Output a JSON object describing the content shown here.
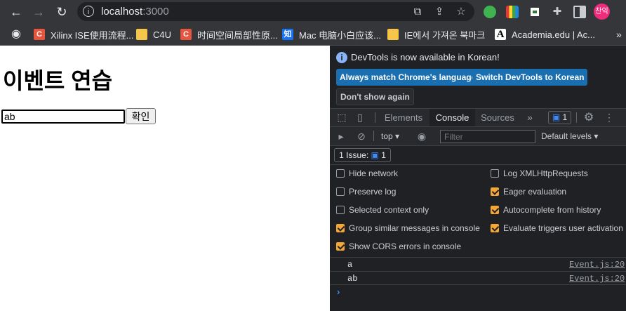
{
  "browser": {
    "url_host": "localhost",
    "url_port": ":3000",
    "profile_initials": "찬익",
    "bookmarks": [
      {
        "label": "Xilinx ISE使用流程...",
        "icon": "C",
        "color": "#e8553e"
      },
      {
        "label": "C4U",
        "icon": "",
        "color": "#f6c64a"
      },
      {
        "label": "时间空间局部性原...",
        "icon": "C",
        "color": "#e8553e"
      },
      {
        "label": "Mac 电脑小白应该...",
        "icon": "知",
        "color": "#1772f6"
      },
      {
        "label": "IE에서 가져온 북마크",
        "icon": "",
        "color": "#f6c64a"
      },
      {
        "label": "Academia.edu | Ac...",
        "icon": "A",
        "color": "#ffffff"
      }
    ]
  },
  "page": {
    "heading": "이벤트 연습",
    "input_value": "ab",
    "confirm_button": "확인"
  },
  "devtools": {
    "info_text": "DevTools is now available in Korean!",
    "btn_match": "Always match Chrome's language",
    "btn_switch": "Switch DevTools to Korean",
    "btn_dont_show": "Don't show again",
    "tabs": [
      "Elements",
      "Console",
      "Sources"
    ],
    "active_tab": "Console",
    "issue_count": "1",
    "context": "top",
    "filter_placeholder": "Filter",
    "levels": "Default levels",
    "issues_label": "1 Issue:",
    "options_left": [
      {
        "label": "Hide network",
        "checked": false
      },
      {
        "label": "Preserve log",
        "checked": false
      },
      {
        "label": "Selected context only",
        "checked": false
      },
      {
        "label": "Group similar messages in console",
        "checked": true
      },
      {
        "label": "Show CORS errors in console",
        "checked": true
      }
    ],
    "options_right": [
      {
        "label": "Log XMLHttpRequests",
        "checked": false
      },
      {
        "label": "Eager evaluation",
        "checked": true
      },
      {
        "label": "Autocomplete from history",
        "checked": true
      },
      {
        "label": "Evaluate triggers user activation",
        "checked": true
      }
    ],
    "messages": [
      {
        "text": "a",
        "source": "Event.js:20"
      },
      {
        "text": "ab",
        "source": "Event.js:20"
      }
    ],
    "prompt_symbol": "›"
  },
  "colors": {
    "accent_blue": "#1a6fb0",
    "checkbox_on": "#f6a633",
    "avatar": "#ef2b7c"
  }
}
